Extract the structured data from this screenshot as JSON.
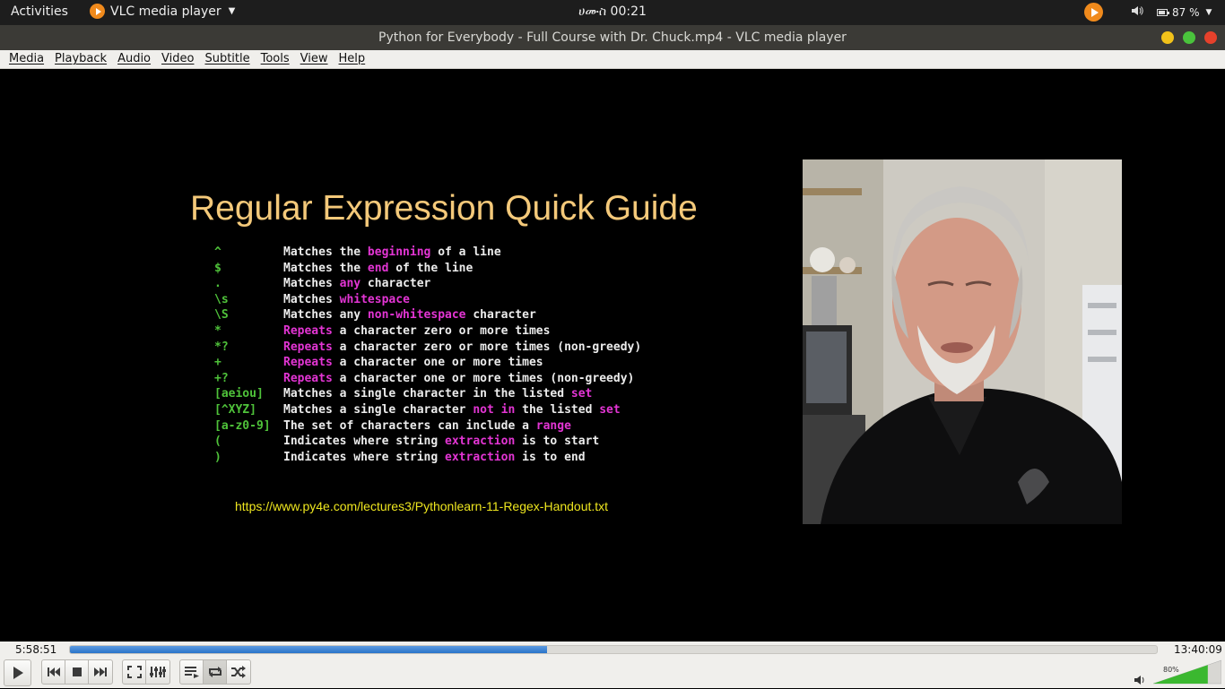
{
  "topbar": {
    "activities": "Activities",
    "app_name": "VLC media player",
    "clock": "ሀሙስ 00:21",
    "battery": "87 %"
  },
  "window": {
    "title": "Python for Everybody - Full Course with Dr. Chuck.mp4 - VLC media player"
  },
  "menu": [
    "Media",
    "Playback",
    "Audio",
    "Video",
    "Subtitle",
    "Tools",
    "View",
    "Help"
  ],
  "slide": {
    "title": "Regular Expression Quick Guide",
    "url": "https://www.py4e.com/lectures3/Pythonlearn-11-Regex-Handout.txt",
    "rows": [
      {
        "token": "^",
        "parts": [
          {
            "t": "Matches the "
          },
          {
            "t": "beginning",
            "hl": true
          },
          {
            "t": " of a line"
          }
        ]
      },
      {
        "token": "$",
        "parts": [
          {
            "t": "Matches the "
          },
          {
            "t": "end",
            "hl": true
          },
          {
            "t": " of the line"
          }
        ]
      },
      {
        "token": ".",
        "parts": [
          {
            "t": "Matches "
          },
          {
            "t": "any",
            "hl": true
          },
          {
            "t": " character"
          }
        ]
      },
      {
        "token": "\\s",
        "parts": [
          {
            "t": "Matches "
          },
          {
            "t": "whitespace",
            "hl": true
          }
        ]
      },
      {
        "token": "\\S",
        "parts": [
          {
            "t": "Matches any "
          },
          {
            "t": "non-whitespace",
            "hl": true
          },
          {
            "t": " character"
          }
        ]
      },
      {
        "token": "*",
        "parts": [
          {
            "t": "Repeats",
            "hl": true
          },
          {
            "t": " a character zero or more times"
          }
        ]
      },
      {
        "token": "*?",
        "parts": [
          {
            "t": "Repeats",
            "hl": true
          },
          {
            "t": " a character zero or more times (non-greedy)"
          }
        ]
      },
      {
        "token": "+",
        "parts": [
          {
            "t": "Repeats",
            "hl": true
          },
          {
            "t": " a character one or more times"
          }
        ]
      },
      {
        "token": "+?",
        "parts": [
          {
            "t": "Repeats",
            "hl": true
          },
          {
            "t": " a character one or more times (non-greedy)"
          }
        ]
      },
      {
        "token": "[aeiou]",
        "parts": [
          {
            "t": "Matches a single character in the listed "
          },
          {
            "t": "set",
            "hl": true
          }
        ]
      },
      {
        "token": "[^XYZ]",
        "parts": [
          {
            "t": "Matches a single character "
          },
          {
            "t": "not in",
            "hl": true
          },
          {
            "t": " the listed "
          },
          {
            "t": "set",
            "hl": true
          }
        ]
      },
      {
        "token": "[a-z0-9]",
        "parts": [
          {
            "t": "The set of characters can include a "
          },
          {
            "t": "range",
            "hl": true
          }
        ]
      },
      {
        "token": "(",
        "parts": [
          {
            "t": "Indicates where string "
          },
          {
            "t": "extraction",
            "hl": true
          },
          {
            "t": " is to start"
          }
        ]
      },
      {
        "token": ")",
        "parts": [
          {
            "t": "Indicates where string "
          },
          {
            "t": "extraction",
            "hl": true
          },
          {
            "t": " is to end"
          }
        ]
      }
    ]
  },
  "player": {
    "elapsed": "5:58:51",
    "total": "13:40:09",
    "progress": 0.439,
    "volume_label": "80%",
    "volume": 0.8
  },
  "colors": {
    "accent_vlc": "#f08a1c",
    "slide_title": "#f4c97a",
    "token_green": "#4fc23a",
    "highlight_magenta": "#e335d4",
    "url_yellow": "#eee61f",
    "seek_blue": "#2a74c9"
  },
  "icons": {
    "play": "play-icon",
    "prev": "previous-icon",
    "stop": "stop-icon",
    "next": "next-icon",
    "fullscreen": "fullscreen-icon",
    "extended": "equalizer-icon",
    "playlist": "playlist-icon",
    "loop": "loop-icon",
    "random": "shuffle-icon",
    "mute": "speaker-icon"
  }
}
